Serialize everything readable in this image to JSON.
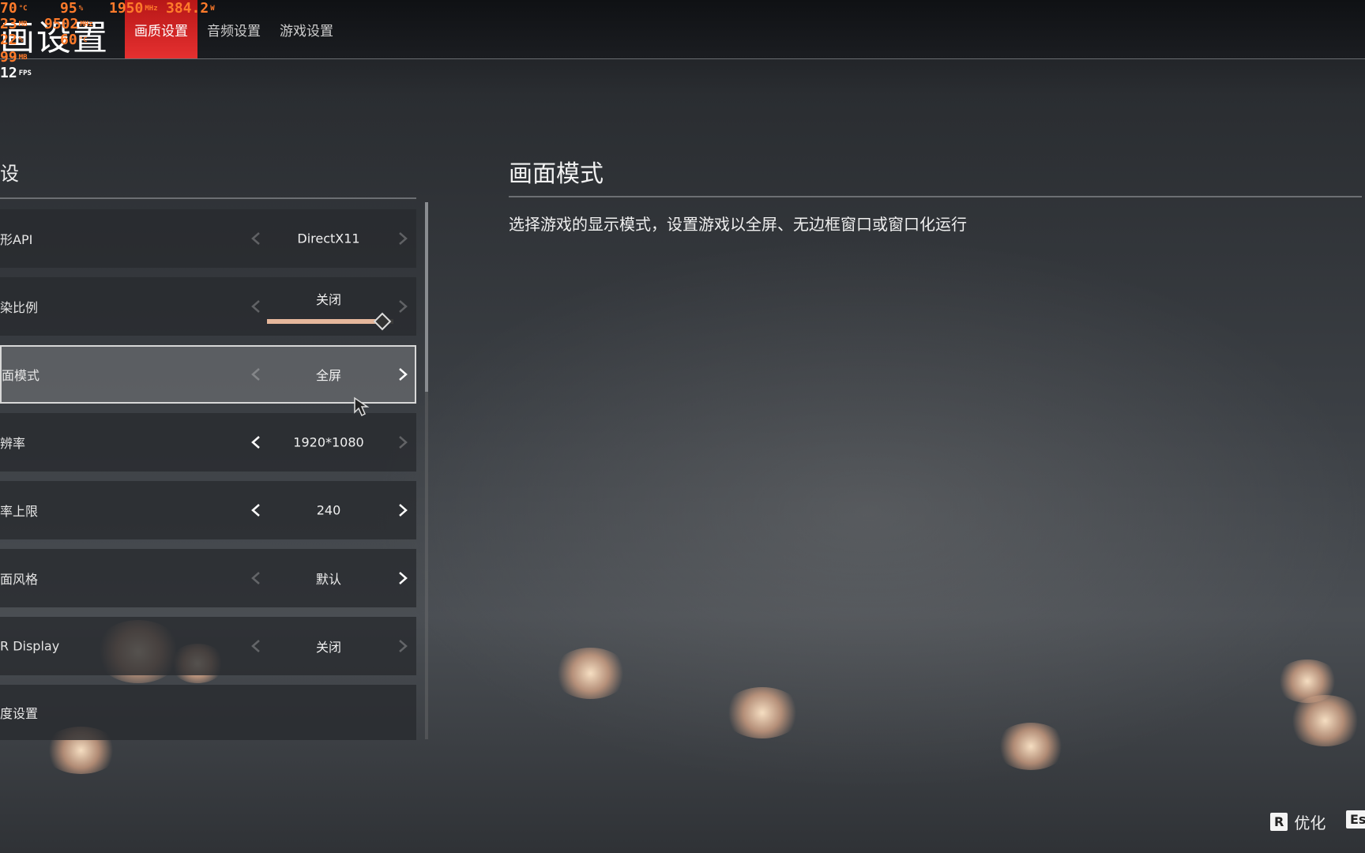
{
  "header": {
    "title": "画设置",
    "tabs": [
      {
        "label": "画质设置",
        "active": true
      },
      {
        "label": "音频设置",
        "active": false
      },
      {
        "label": "游戏设置",
        "active": false
      }
    ]
  },
  "overlay": {
    "temp": "70",
    "temp_unit": "°C",
    "load": "95",
    "load_unit": "%",
    "clock": "1950",
    "clock_unit": "MHz",
    "power": "384.2",
    "power_unit": "W",
    "row2a": "23",
    "row2a_unit": "MB",
    "row2b": "9502",
    "row2b_unit": "MHz",
    "row3a": "22",
    "row3a_unit": "%",
    "row3b": "60",
    "row3b_unit": "°C",
    "row4": "99",
    "row4_unit": "MB",
    "fps": "12",
    "fps_unit": "FPS"
  },
  "left_panel": {
    "section_title": "设",
    "rows": [
      {
        "label": "形API",
        "value": "DirectX11",
        "left_enabled": false,
        "right_enabled": false
      },
      {
        "label": "染比例",
        "value": "关闭",
        "left_enabled": false,
        "right_enabled": false,
        "slider_level": 0.9
      },
      {
        "label": "面模式",
        "value": "全屏",
        "left_enabled": false,
        "right_enabled": true,
        "selected": true
      },
      {
        "label": "辨率",
        "value": "1920*1080",
        "left_enabled": true,
        "right_enabled": false
      },
      {
        "label": "率上限",
        "value": "240",
        "left_enabled": true,
        "right_enabled": true
      },
      {
        "label": "面风格",
        "value": "默认",
        "left_enabled": false,
        "right_enabled": true
      },
      {
        "label": "R Display",
        "value": "关闭",
        "left_enabled": false,
        "right_enabled": false
      },
      {
        "label": "度设置"
      }
    ]
  },
  "right_panel": {
    "title": "画面模式",
    "description": "选择游戏的显示模式，设置游戏以全屏、无边框窗口或窗口化运行"
  },
  "footer": {
    "optimize_key": "R",
    "optimize_label": "优化",
    "esc_key": "Es"
  },
  "colors": {
    "accent_red": "#e53030",
    "slider_fill": "#e6b79c",
    "overlay_orange": "#ff7b2b"
  },
  "icons": {
    "left_arrow": "chevron-left-icon",
    "right_arrow": "chevron-right-icon",
    "cursor": "mouse-pointer-icon"
  }
}
